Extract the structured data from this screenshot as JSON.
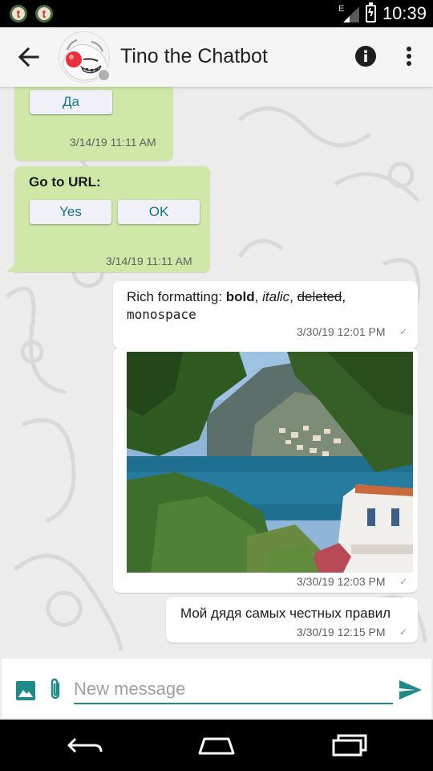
{
  "status_bar": {
    "network_label": "E",
    "time": "10:39",
    "app_icon_letter": "t"
  },
  "header": {
    "title": "Tino the Chatbot",
    "presence": "offline"
  },
  "messages": {
    "m1": {
      "button": "Да",
      "time": "3/14/19 11:11 AM"
    },
    "m2": {
      "title": "Go to URL:",
      "button_yes": "Yes",
      "button_ok": "OK",
      "time": "3/14/19 11:11 AM"
    },
    "m3": {
      "prefix": "Rich formatting: ",
      "bold": "bold",
      "sep1": ", ",
      "italic": "italic",
      "sep2": ", ",
      "deleted": "deleted",
      "sep3": ",",
      "mono": "monospace",
      "time": "3/30/19 12:01 PM",
      "tick": "✓"
    },
    "m4": {
      "time": "3/30/19 12:03 PM",
      "tick": "✓"
    },
    "m5": {
      "text": "Мой дядя самых честных правил",
      "time": "3/30/19 12:15 PM",
      "tick": "✓"
    }
  },
  "composer": {
    "placeholder": "New message"
  },
  "colors": {
    "incoming_bubble": "#cfe8a8",
    "outgoing_bubble": "#ffffff",
    "accent": "#1f8a8a",
    "button_text": "#147a7a"
  },
  "icons": {
    "back": "arrow-left-icon",
    "info": "info-icon",
    "menu": "more-vert-icon",
    "image": "image-icon",
    "attach": "paperclip-icon",
    "send": "send-icon"
  }
}
